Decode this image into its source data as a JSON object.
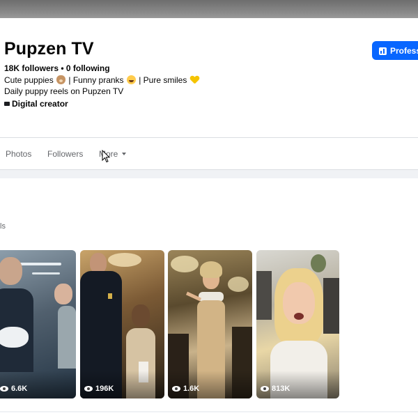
{
  "profile": {
    "name": "Pupzen TV",
    "followers_line": "18K followers • 0 following",
    "bio": {
      "part1": "Cute puppies ",
      "part2": " | Funny pranks ",
      "part3": " | Pure smiles ",
      "line2": "Daily puppy reels on Pupzen TV"
    },
    "category": "Digital creator",
    "professional_button": "Professional dashboard"
  },
  "tabs": {
    "photos": "Photos",
    "followers": "Followers",
    "more": "More"
  },
  "reels": {
    "heading": "ls",
    "items": [
      {
        "views": "6.6K"
      },
      {
        "views": "196K"
      },
      {
        "views": "1.6K"
      },
      {
        "views": "813K"
      }
    ]
  },
  "colors": {
    "accent": "#0866ff",
    "page_background": "#f0f2f5",
    "card_background": "#ffffff",
    "secondary_text": "#65676b"
  },
  "icons": [
    "dashboard-icon",
    "category-icon",
    "caret-down-icon",
    "eye-icon",
    "mouse-cursor-icon"
  ]
}
